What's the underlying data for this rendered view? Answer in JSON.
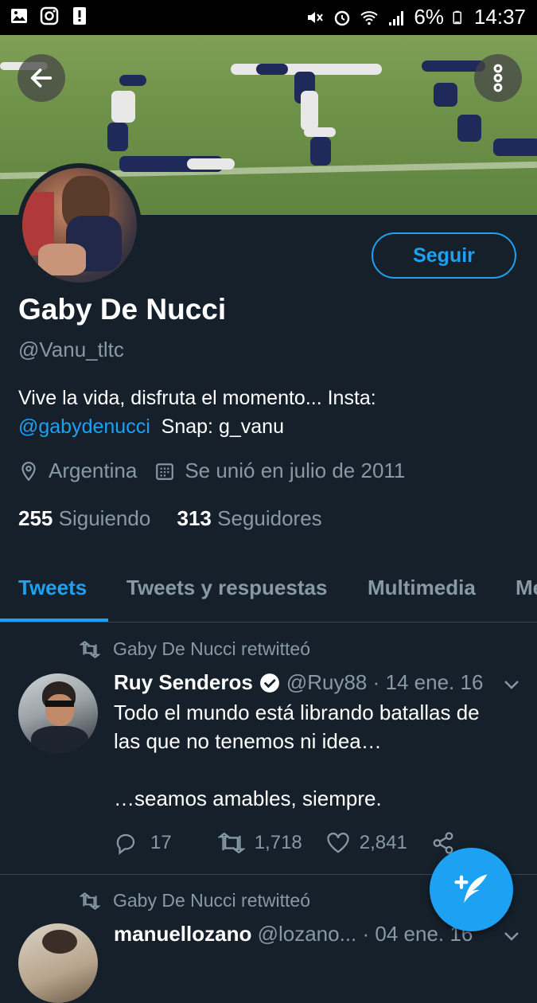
{
  "status_bar": {
    "battery": "6%",
    "time": "14:37"
  },
  "profile": {
    "name": "Gaby De Nucci",
    "handle": "@Vanu_tltc",
    "bio_text": "Vive la vida, disfruta el momento...   Insta:",
    "bio_link": "@gabydenucci",
    "bio_snap": "Snap: g_vanu",
    "location": "Argentina",
    "joined": "Se unió en julio de 2011",
    "following_count": "255",
    "following_label": "Siguiendo",
    "followers_count": "313",
    "followers_label": "Seguidores",
    "follow_button": "Seguir"
  },
  "tabs": [
    "Tweets",
    "Tweets y respuestas",
    "Multimedia",
    "Me"
  ],
  "tweets": [
    {
      "retweeted_by": "Gaby De Nucci retwitteó",
      "author": "Ruy Senderos",
      "author_handle": "@Ruy88",
      "date": "· 14 ene. 16",
      "text_line1": "Todo el mundo está librando batallas de",
      "text_line2": "las que no tenemos ni idea…",
      "text_line3": "…seamos amables, siempre.",
      "replies": "17",
      "retweets": "1,718",
      "likes": "2,841"
    },
    {
      "retweeted_by": "Gaby De Nucci retwitteó",
      "author": "manuellozano",
      "author_handle": "@lozano...",
      "date": "· 04 ene. 16"
    }
  ],
  "colors": {
    "accent": "#1da1f2",
    "background": "#15202b",
    "muted": "#8899a6"
  }
}
